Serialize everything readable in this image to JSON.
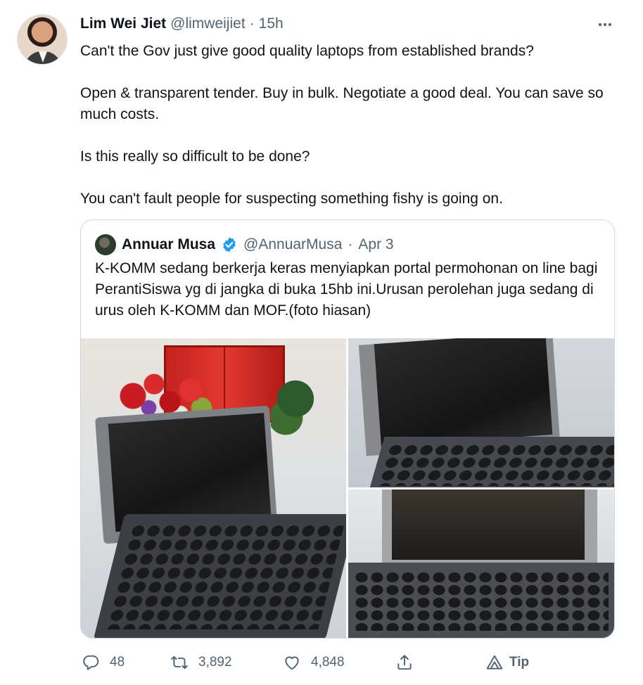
{
  "tweet": {
    "author_name": "Lim Wei Jiet",
    "author_handle": "@limweijiet",
    "separator": "·",
    "time": "15h",
    "paragraphs": [
      "Can't the Gov just give good quality laptops from established brands?",
      "Open & transparent tender. Buy in bulk. Negotiate a good deal. You can save so much costs.",
      "Is this really so difficult to be done?",
      "You can't fault people for suspecting something fishy is going on."
    ]
  },
  "quote": {
    "author_name": "Annuar Musa",
    "author_handle": "@AnnuarMusa",
    "separator": "·",
    "time": "Apr 3",
    "text": "K-KOMM sedang berkerja keras menyiapkan portal permohonan on line bagi PerantiSiswa yg di jangka di buka 15hb ini.Urusan perolehan juga sedang di urus oleh K-KOMM dan MOF.(foto hiasan)"
  },
  "actions": {
    "reply_count": "48",
    "retweet_count": "3,892",
    "like_count": "4,848",
    "tip_label": "Tip"
  },
  "icons": {
    "more": "more-icon",
    "verified": "verified-badge-icon",
    "reply": "reply-icon",
    "retweet": "retweet-icon",
    "like": "heart-icon",
    "share": "share-icon",
    "tip": "tip-icon"
  },
  "colors": {
    "text": "#0f1419",
    "secondary": "#536471",
    "verified_blue": "#1d9bf0",
    "border": "#cfd9de"
  }
}
